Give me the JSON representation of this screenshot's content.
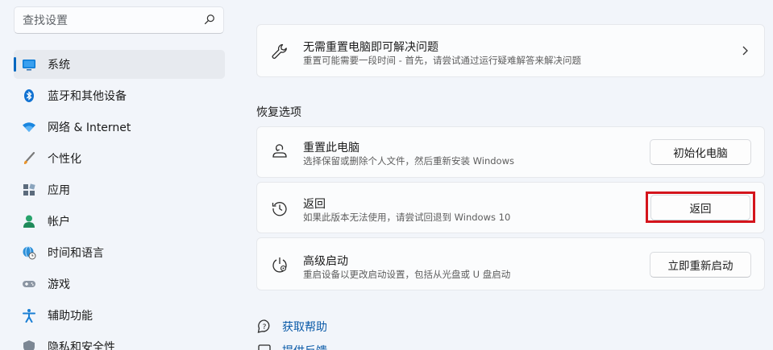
{
  "search": {
    "placeholder": "查找设置",
    "icon": "search-icon"
  },
  "sidebar": {
    "items": [
      {
        "label": "系统",
        "icon": "monitor-icon",
        "active": true
      },
      {
        "label": "蓝牙和其他设备",
        "icon": "bluetooth-icon"
      },
      {
        "label": "网络 & Internet",
        "icon": "wifi-icon"
      },
      {
        "label": "个性化",
        "icon": "brush-icon"
      },
      {
        "label": "应用",
        "icon": "apps-icon"
      },
      {
        "label": "帐户",
        "icon": "account-icon"
      },
      {
        "label": "时间和语言",
        "icon": "globe-clock-icon"
      },
      {
        "label": "游戏",
        "icon": "gamepad-icon"
      },
      {
        "label": "辅助功能",
        "icon": "accessibility-icon"
      },
      {
        "label": "隐私和安全性",
        "icon": "shield-icon"
      }
    ]
  },
  "main": {
    "troubleshoot": {
      "title": "无需重置电脑即可解决问题",
      "subtitle": "重置可能需要一段时间 - 首先，请尝试通过运行疑难解答来解决问题",
      "icon": "wrench-icon"
    },
    "section_title": "恢复选项",
    "options": [
      {
        "title": "重置此电脑",
        "subtitle": "选择保留或删除个人文件，然后重新安装 Windows",
        "button": "初始化电脑",
        "icon": "reset-pc-icon"
      },
      {
        "title": "返回",
        "subtitle": "如果此版本无法使用，请尝试回退到 Windows 10",
        "button": "返回",
        "icon": "history-icon"
      },
      {
        "title": "高级启动",
        "subtitle": "重启设备以更改启动设置，包括从光盘或 U 盘启动",
        "button": "立即重新启动",
        "icon": "advanced-startup-icon"
      }
    ],
    "links": [
      {
        "label": "获取帮助",
        "icon": "help-icon"
      },
      {
        "label": "提供反馈",
        "icon": "feedback-icon"
      }
    ]
  },
  "colors": {
    "accent": "#0067c0",
    "highlight": "#d4141c",
    "link": "#0a5aa8"
  }
}
